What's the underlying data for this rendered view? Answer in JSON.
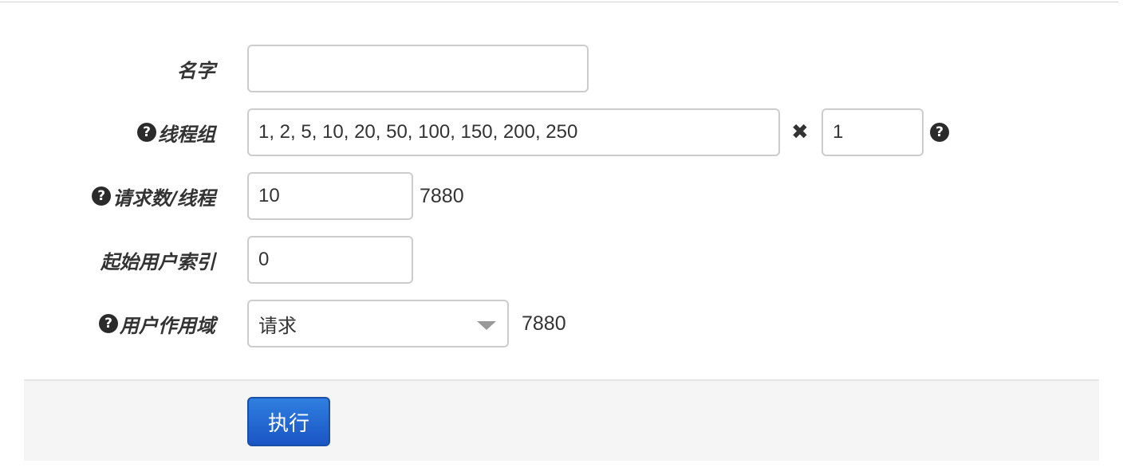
{
  "form": {
    "name": {
      "label": "名字",
      "value": ""
    },
    "thread_groups": {
      "label": "线程组",
      "help_icon": "?",
      "value": "1, 2, 5, 10, 20, 50, 100, 150, 200, 250",
      "multiply_symbol": "✖",
      "multiplier_value": "1",
      "multiplier_help_icon": "?"
    },
    "requests_per_thread": {
      "label": "请求数/线程",
      "help_icon": "?",
      "value": "10",
      "total": "7880"
    },
    "start_user_index": {
      "label": "起始用户索引",
      "value": "0"
    },
    "user_scope": {
      "label": "用户作用域",
      "help_icon": "?",
      "selected": "请求",
      "total": "7880"
    }
  },
  "actions": {
    "run_label": "执行"
  },
  "colors": {
    "primary_button": "#1b55c4",
    "input_border": "#cccccc",
    "action_bar_bg": "#f5f5f5"
  },
  "icons": {
    "help": "question-circle-icon",
    "multiply": "times-icon",
    "caret": "caret-down-icon"
  }
}
